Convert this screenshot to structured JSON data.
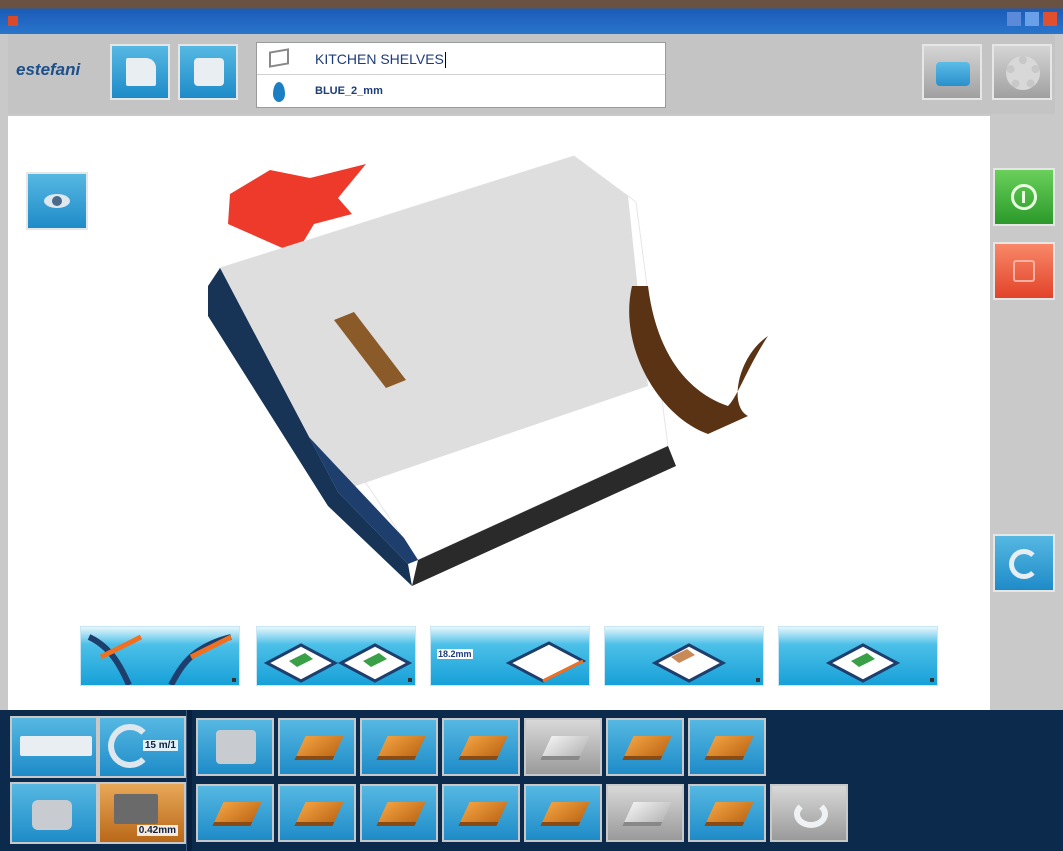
{
  "window": {
    "title": ""
  },
  "topbar": {
    "logo": "estefani",
    "project_name": "KITCHEN SHELVES",
    "edge_profile": "BLUE_2_mm"
  },
  "presets": [
    {
      "label": "radius-left-right"
    },
    {
      "label": "side-1-side-2"
    },
    {
      "label": "thickness",
      "thickness_text": "18.2mm"
    },
    {
      "label": "single-edge"
    },
    {
      "label": "edge-7"
    }
  ],
  "bottom": {
    "speed_text": "15 m/1",
    "thickness_text": "0.42mm"
  },
  "colors": {
    "accent_blue": "#1e8bc8",
    "start_green": "#2a9a2a",
    "stop_red": "#e2432a",
    "edge_band": "#1e3f6e",
    "edge_tape": "#5a3214"
  }
}
